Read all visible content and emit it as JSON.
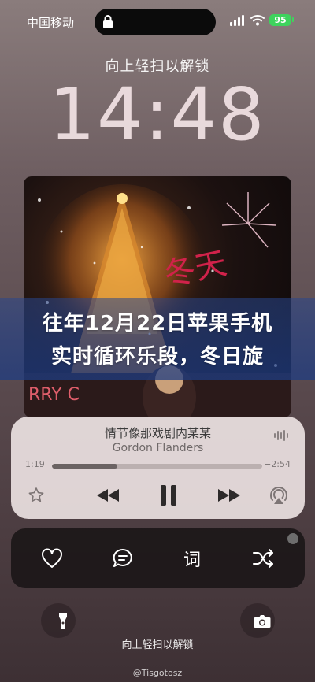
{
  "status_bar": {
    "carrier": "中国移动",
    "battery": "95"
  },
  "lock_screen": {
    "swipe_hint_top": "向上轻扫以解锁",
    "time": "14:48",
    "swipe_hint_bottom": "向上轻扫以解锁"
  },
  "headline": {
    "line1": "往年12月22日苹果手机",
    "line2": "实时循环乐段，冬日旋"
  },
  "player": {
    "title": "情节像那戏剧内某某",
    "artist": "Gordon Flanders",
    "elapsed": "1:19",
    "remaining": "−2:54",
    "progress": 0.31
  },
  "actions": {
    "lyrics_label": "词"
  },
  "watermark": "@Tisgotosz",
  "colors": {
    "battery": "#3ed35d",
    "headline_band": "#2a4a8c"
  },
  "icons": [
    "lock-icon",
    "signal-icon",
    "wifi-icon",
    "waveform-icon",
    "star-icon",
    "previous-icon",
    "pause-icon",
    "next-icon",
    "airplay-icon",
    "heart-icon",
    "comment-icon",
    "shuffle-icon",
    "flashlight-icon",
    "camera-icon"
  ]
}
